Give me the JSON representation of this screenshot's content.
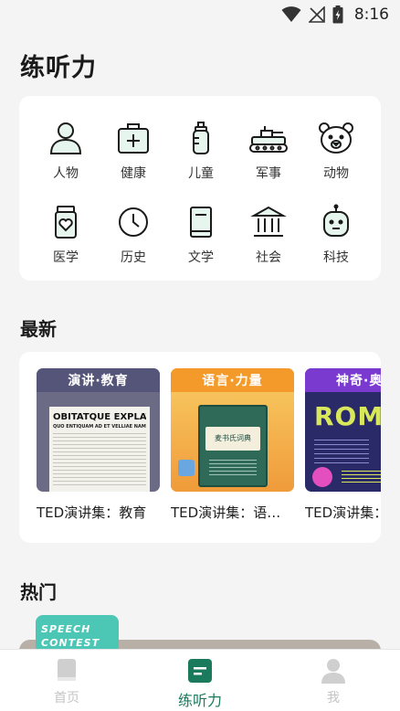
{
  "status": {
    "time": "8:16"
  },
  "page": {
    "title": "练听力"
  },
  "categories": [
    {
      "label": "人物",
      "icon": "person-icon"
    },
    {
      "label": "健康",
      "icon": "medical-kit-icon"
    },
    {
      "label": "儿童",
      "icon": "baby-bottle-icon"
    },
    {
      "label": "军事",
      "icon": "tank-icon"
    },
    {
      "label": "动物",
      "icon": "bear-icon"
    },
    {
      "label": "医学",
      "icon": "medicine-bottle-icon"
    },
    {
      "label": "历史",
      "icon": "clock-icon"
    },
    {
      "label": "文学",
      "icon": "book-icon"
    },
    {
      "label": "社会",
      "icon": "institution-icon"
    },
    {
      "label": "科技",
      "icon": "robot-icon"
    }
  ],
  "latest": {
    "title": "最新",
    "items": [
      {
        "tag": "演讲·教育",
        "name": "TED演讲集：教育",
        "cover_headline": "OBITATQUE EXPLATIS",
        "cover_sub": "QUO ENTIQUAM AD ET VELLIAE NAM"
      },
      {
        "tag": "语言·力量",
        "name": "TED演讲集：语言·力量",
        "cover_book": "麦书氏词典"
      },
      {
        "tag": "神奇·奥秘",
        "name": "TED演讲集：神奇·奥秘",
        "cover_headline": "ROMA ESSE"
      }
    ]
  },
  "hot": {
    "title": "热门",
    "badge_line1": "SPEECH",
    "badge_line2": "CONTEST"
  },
  "nav": [
    {
      "label": "首页",
      "icon": "home-book-icon",
      "active": false
    },
    {
      "label": "练听力",
      "icon": "listening-icon",
      "active": true
    },
    {
      "label": "我",
      "icon": "profile-icon",
      "active": false
    }
  ],
  "colors": {
    "accent": "#1a7a5c",
    "card": "#ffffff",
    "background": "#f4f4f5"
  }
}
